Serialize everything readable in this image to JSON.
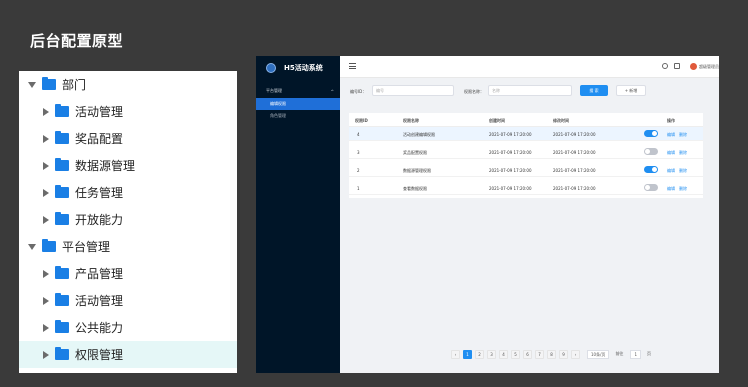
{
  "slide": {
    "title": "后台配置原型"
  },
  "tree": [
    {
      "label": "部门",
      "level": 0,
      "expanded": true,
      "selected": false
    },
    {
      "label": "活动管理",
      "level": 1,
      "expanded": false,
      "selected": false
    },
    {
      "label": "奖品配置",
      "level": 1,
      "expanded": false,
      "selected": false
    },
    {
      "label": "数据源管理",
      "level": 1,
      "expanded": false,
      "selected": false
    },
    {
      "label": "任务管理",
      "level": 1,
      "expanded": false,
      "selected": false
    },
    {
      "label": "开放能力",
      "level": 1,
      "expanded": false,
      "selected": false
    },
    {
      "label": "平台管理",
      "level": 0,
      "expanded": true,
      "selected": false
    },
    {
      "label": "产品管理",
      "level": 1,
      "expanded": false,
      "selected": false
    },
    {
      "label": "活动管理",
      "level": 1,
      "expanded": false,
      "selected": false
    },
    {
      "label": "公共能力",
      "level": 1,
      "expanded": false,
      "selected": false
    },
    {
      "label": "权限管理",
      "level": 1,
      "expanded": false,
      "selected": true
    }
  ],
  "app": {
    "logo": "H5活动系统",
    "sidebar": {
      "group": "平台管理",
      "items": [
        {
          "label": "编辑权限",
          "active": true
        },
        {
          "label": "角色管理",
          "active": false
        }
      ]
    },
    "user": "超级管理员",
    "filter": {
      "id_label": "编号ID：",
      "id_placeholder": "编号",
      "name_label": "权限名称：",
      "name_placeholder": "名称",
      "search": "搜 索",
      "add": "+ 新增"
    },
    "table": {
      "headers": [
        "权限ID",
        "权限名称",
        "创建时间",
        "修改时间",
        "操作"
      ],
      "rows": [
        {
          "id": "4",
          "name": "活动创建编辑权限",
          "created": "2021-07-09 17:20:00",
          "modified": "2021-07-09 17:20:00",
          "enabled": true,
          "actions": [
            "编辑",
            "删除"
          ]
        },
        {
          "id": "3",
          "name": "奖品配置权限",
          "created": "2021-07-09 17:20:00",
          "modified": "2021-07-09 17:20:00",
          "enabled": false,
          "actions": [
            "编辑",
            "删除"
          ]
        },
        {
          "id": "2",
          "name": "数据源管理权限",
          "created": "2021-07-09 17:20:00",
          "modified": "2021-07-09 17:20:00",
          "enabled": true,
          "actions": [
            "编辑",
            "删除"
          ]
        },
        {
          "id": "1",
          "name": "查看数据权限",
          "created": "2021-07-09 17:20:00",
          "modified": "2021-07-09 17:20:00",
          "enabled": false,
          "actions": [
            "编辑",
            "删除"
          ]
        }
      ]
    },
    "pagination": {
      "pages": [
        "1",
        "2",
        "3",
        "4",
        "5",
        "6",
        "7",
        "8",
        "9"
      ],
      "current": "1",
      "page_size": "10条/页",
      "goto_label": "前往",
      "goto_value": "1",
      "goto_suffix": "页"
    }
  },
  "colors": {
    "accent": "#1f8ef1",
    "folder": "#1a7fe5",
    "sidebar": "#001528",
    "selected_row": "#e5f7f7"
  }
}
